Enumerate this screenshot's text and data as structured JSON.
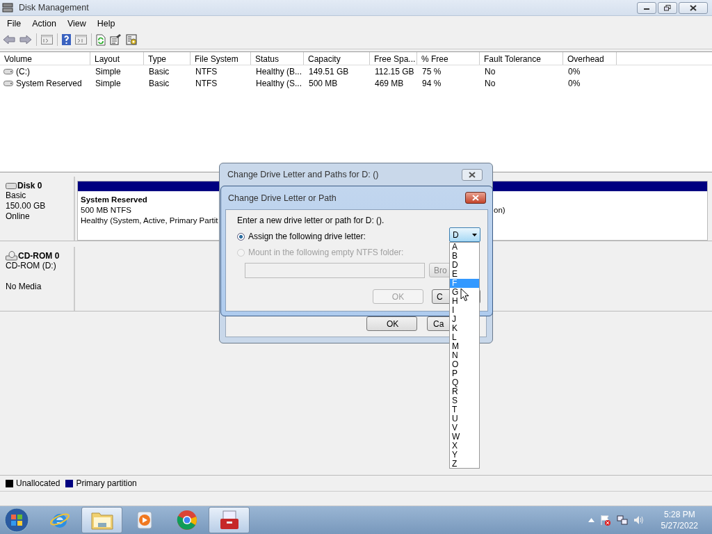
{
  "window": {
    "title": "Disk Management"
  },
  "menu": [
    "File",
    "Action",
    "View",
    "Help"
  ],
  "volumes": {
    "columns": [
      "Volume",
      "Layout",
      "Type",
      "File System",
      "Status",
      "Capacity",
      "Free Spa...",
      "% Free",
      "Fault Tolerance",
      "Overhead"
    ],
    "rows": [
      {
        "cells": [
          "(C:)",
          "Simple",
          "Basic",
          "NTFS",
          "Healthy (B...",
          "149.51 GB",
          "112.15 GB",
          "75 %",
          "No",
          "0%"
        ]
      },
      {
        "cells": [
          "System Reserved",
          "Simple",
          "Basic",
          "NTFS",
          "Healthy (S...",
          "500 MB",
          "469 MB",
          "94 %",
          "No",
          "0%"
        ]
      }
    ]
  },
  "disks": [
    {
      "kind": "disk",
      "name": "Disk 0",
      "lines": [
        "Basic",
        "150.00 GB",
        "Online"
      ],
      "partitions": [
        {
          "lines": [
            "System Reserved",
            "500 MB NTFS",
            "Healthy (System, Active, Primary Partit"
          ]
        },
        {
          "lines": [
            "on)"
          ]
        }
      ]
    },
    {
      "kind": "cdrom",
      "name": "CD-ROM 0",
      "lines": [
        "CD-ROM (D:)",
        "No Media"
      ]
    }
  ],
  "legend": [
    {
      "label": "Unallocated",
      "color": "#000000"
    },
    {
      "label": "Primary partition",
      "color": "#000080"
    }
  ],
  "outer_dialog": {
    "title": "Change Drive Letter and Paths for D: ()",
    "buttons": [
      "OK",
      "Ca"
    ]
  },
  "dialog": {
    "title": "Change Drive Letter or Path",
    "prompt": "Enter a new drive letter or path for D: ().",
    "options": [
      {
        "label": "Assign the following drive letter:",
        "selected": true,
        "disabled": false
      },
      {
        "label": "Mount in the following empty NTFS folder:",
        "selected": false,
        "disabled": true
      }
    ],
    "browse": "Bro",
    "ok": {
      "label": "OK",
      "disabled": true
    },
    "cancel": "C",
    "drive_select": {
      "value": "D",
      "expanded": true
    },
    "letters": [
      {
        "label": "A",
        "selected": false
      },
      {
        "label": "B",
        "selected": false
      },
      {
        "label": "D",
        "selected": false
      },
      {
        "label": "E",
        "selected": false
      },
      {
        "label": "F",
        "selected": true
      },
      {
        "label": "G",
        "selected": false
      },
      {
        "label": "H",
        "selected": false
      },
      {
        "label": "I",
        "selected": false
      },
      {
        "label": "J",
        "selected": false
      },
      {
        "label": "K",
        "selected": false
      },
      {
        "label": "L",
        "selected": false
      },
      {
        "label": "M",
        "selected": false
      },
      {
        "label": "N",
        "selected": false
      },
      {
        "label": "O",
        "selected": false
      },
      {
        "label": "P",
        "selected": false
      },
      {
        "label": "Q",
        "selected": false
      },
      {
        "label": "R",
        "selected": false
      },
      {
        "label": "S",
        "selected": false
      },
      {
        "label": "T",
        "selected": false
      },
      {
        "label": "U",
        "selected": false
      },
      {
        "label": "V",
        "selected": false
      },
      {
        "label": "W",
        "selected": false
      },
      {
        "label": "X",
        "selected": false
      },
      {
        "label": "Y",
        "selected": false
      },
      {
        "label": "Z",
        "selected": false
      }
    ]
  },
  "taskbar": {
    "apps": [
      {
        "kind": "browser-e",
        "active": false
      },
      {
        "kind": "folder",
        "active": true
      },
      {
        "kind": "media",
        "active": false
      },
      {
        "kind": "chrome",
        "active": false
      },
      {
        "kind": "toolbox",
        "active": true
      }
    ]
  },
  "clock": {
    "time": "5:28 PM",
    "date": "5/27/2022"
  }
}
